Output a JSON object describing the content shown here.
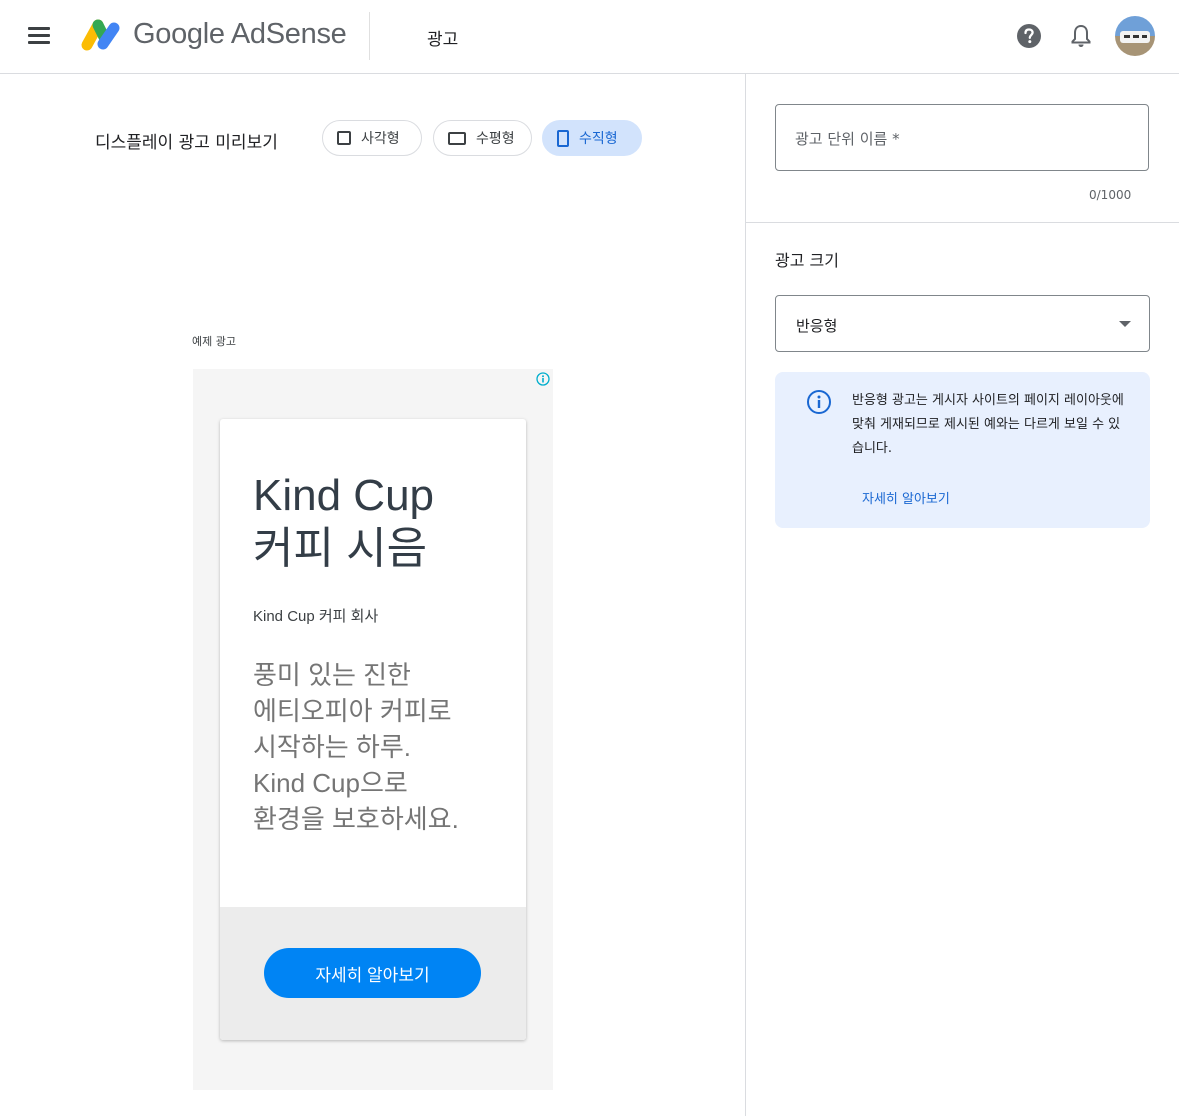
{
  "header": {
    "brand": "Google AdSense",
    "page_title": "광고",
    "icons": [
      "menu-icon",
      "adsense-logo",
      "help-icon",
      "bell-icon",
      "avatar"
    ]
  },
  "preview": {
    "label": "디스플레이 광고 미리보기",
    "chips": [
      {
        "label": "사각형",
        "icon": "square-icon",
        "selected": false
      },
      {
        "label": "수평형",
        "icon": "horizontal-rect-icon",
        "selected": false
      },
      {
        "label": "수직형",
        "icon": "vertical-rect-icon",
        "selected": true
      }
    ],
    "sample_label": "예제 광고"
  },
  "ad": {
    "headline": "Kind Cup\n커피 시음",
    "advertiser": "Kind Cup 커피 회사",
    "description": "풍미 있는 진한\n에티오피아 커피로\n시작하는 하루.\nKind Cup으로\n환경을 보호하세요.",
    "cta_label": "자세히 알아보기",
    "cta_color": "#0084f4"
  },
  "settings": {
    "name_placeholder": "광고 단위 이름 *",
    "name_value": "",
    "counter": "0/1000",
    "size_label": "광고 크기",
    "size_value": "반응형",
    "info_text": "반응형 광고는 게시자 사이트의 페이지 레이아웃에 맞춰 게재되므로 제시된 예와는 다르게 보일 수 있습니다.",
    "learn_more": "자세히 알아보기"
  },
  "colors": {
    "accent": "#1967d2",
    "chip_selected_bg": "#d2e3fc",
    "info_bg": "#e8f0fe",
    "ad_cta": "#0084f4"
  }
}
